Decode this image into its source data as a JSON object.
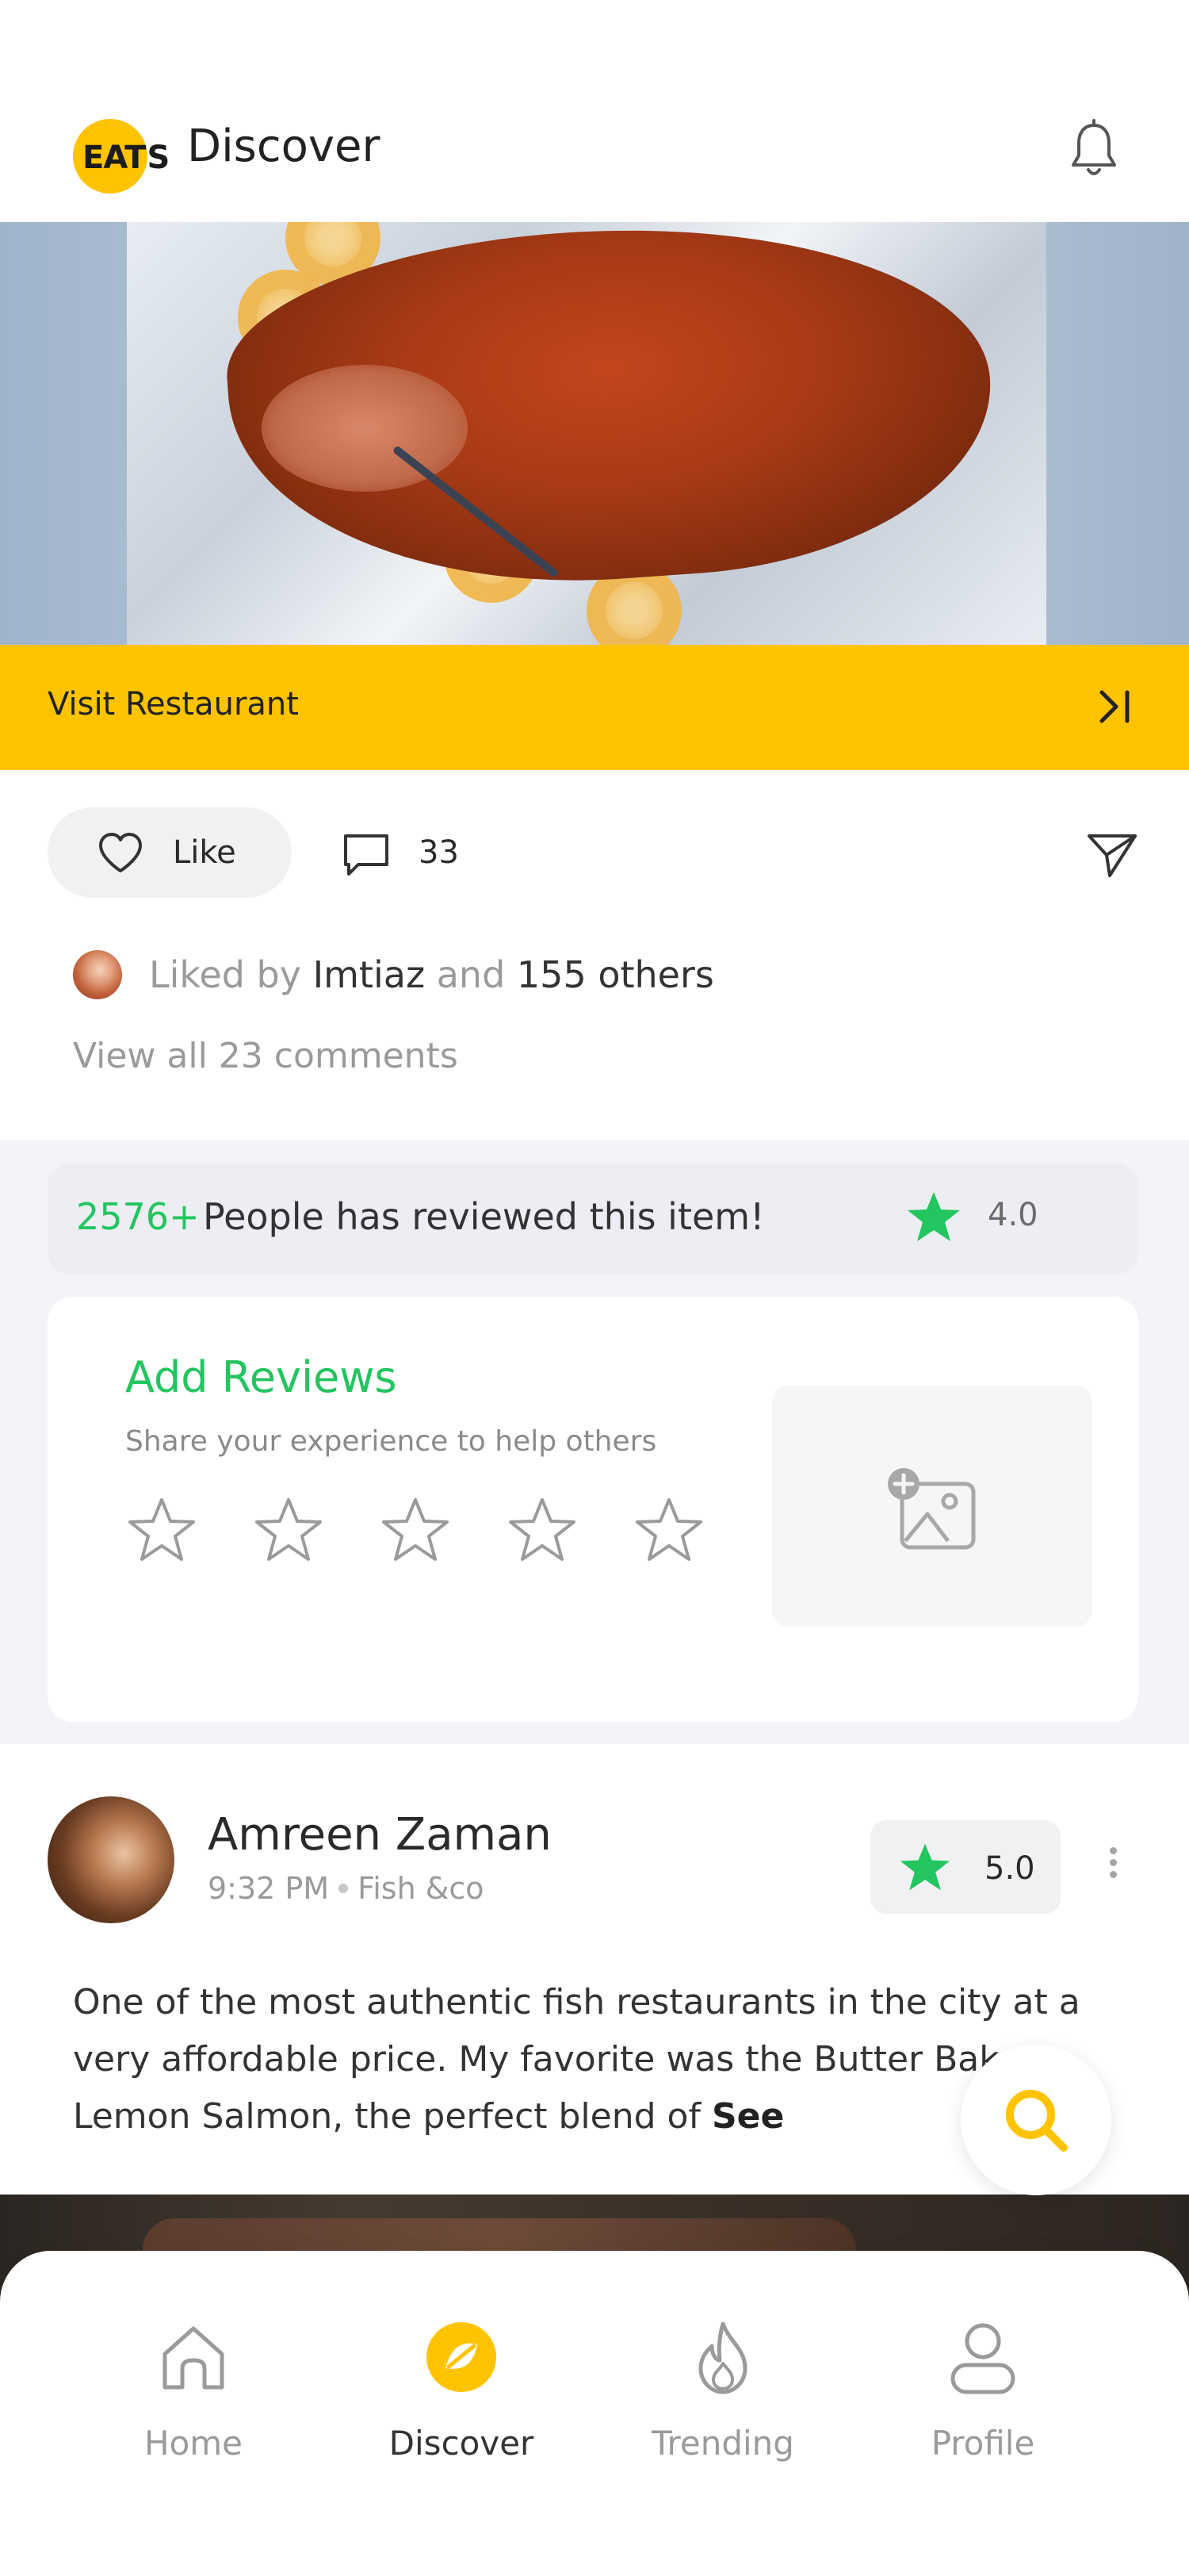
{
  "header": {
    "logo_text": "EATS",
    "logo_main": "EAT",
    "logo_s": "S",
    "title": "Discover"
  },
  "hero": {
    "visit_label": "Visit Restaurant"
  },
  "actions": {
    "like_label": "Like",
    "comment_count": "33"
  },
  "likes": {
    "liked_by_prefix": "Liked by",
    "liked_by_user": "Imtiaz",
    "liked_by_and": "and",
    "liked_by_others": "155 others",
    "view_comments": "View all 23 comments"
  },
  "review_summary": {
    "count": "2576+",
    "text": "People has reviewed this item!",
    "rating": "4.0"
  },
  "add_review": {
    "title": "Add Reviews",
    "subtitle": "Share your experience to help others",
    "star_count": 5
  },
  "post": {
    "author": "Amreen Zaman",
    "time": "9:32 PM",
    "place": "Fish &co",
    "rating": "5.0",
    "text": "One of the most authentic fish restaurants in the city at a very affordable price. My favorite was the Butter Baked Lemon Salmon, the perfect blend of",
    "see_more": "See"
  },
  "nav": {
    "items": [
      {
        "label": "Home",
        "icon": "home-icon",
        "active": false
      },
      {
        "label": "Discover",
        "icon": "discover-icon",
        "active": true
      },
      {
        "label": "Trending",
        "icon": "flame-icon",
        "active": false
      },
      {
        "label": "Profile",
        "icon": "profile-icon",
        "active": false
      }
    ]
  },
  "colors": {
    "brand_yellow": "#FFC300",
    "accent_green": "#22C55E"
  }
}
